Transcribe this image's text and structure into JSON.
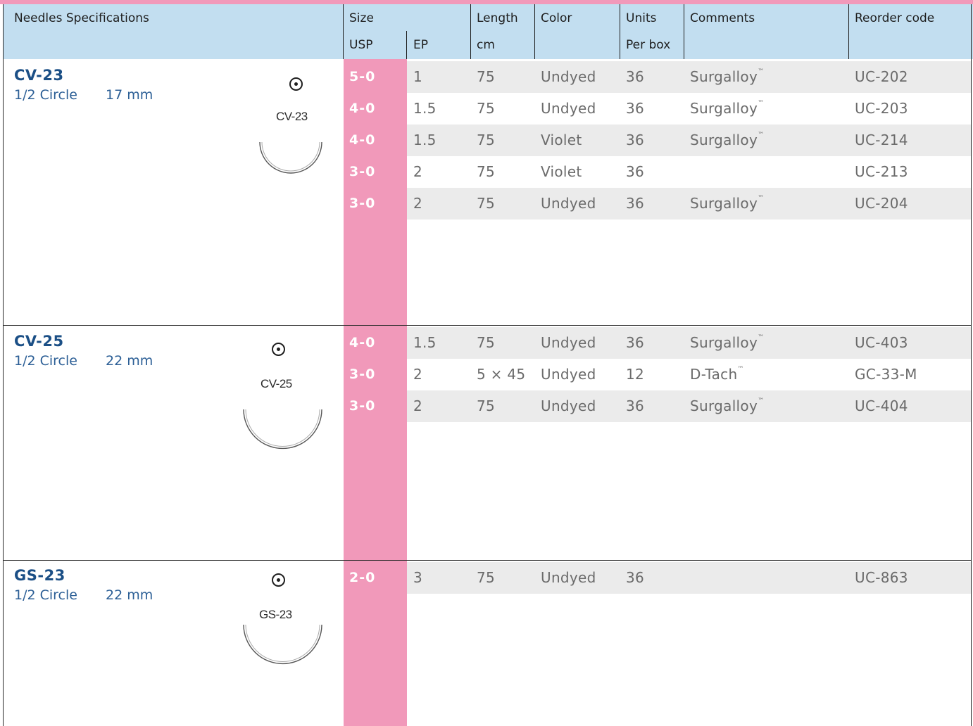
{
  "header": {
    "needles_spec": "Needles Specifications",
    "size": "Size",
    "usp": "USP",
    "ep": "EP",
    "length": "Length",
    "length_unit": "cm",
    "color": "Color",
    "units": "Units",
    "units_sub": "Per box",
    "comments": "Comments",
    "reorder_code": "Reorder code"
  },
  "colors": {
    "accent_pink": "#f199ba",
    "header_blue": "#c2def0",
    "needle_name_blue": "#1b4f86",
    "row_shade": "#ebebeb"
  },
  "groups": [
    {
      "name": "CV-23",
      "shape": "1/2 Circle",
      "size_mm": "17 mm",
      "icon_label": "CV-23",
      "icon": "taper-point-icon",
      "rows": [
        {
          "usp": "5-0",
          "ep": "1",
          "length": "75",
          "color": "Undyed",
          "units": "36",
          "comment": "Surgalloy",
          "tm": "™",
          "code": "UC-202"
        },
        {
          "usp": "4-0",
          "ep": "1.5",
          "length": "75",
          "color": "Undyed",
          "units": "36",
          "comment": "Surgalloy",
          "tm": "™",
          "code": "UC-203"
        },
        {
          "usp": "4-0",
          "ep": "1.5",
          "length": "75",
          "color": "Violet",
          "units": "36",
          "comment": "Surgalloy",
          "tm": "™",
          "code": "UC-214"
        },
        {
          "usp": "3-0",
          "ep": "2",
          "length": "75",
          "color": "Violet",
          "units": "36",
          "comment": "",
          "tm": "",
          "code": "UC-213"
        },
        {
          "usp": "3-0",
          "ep": "2",
          "length": "75",
          "color": "Undyed",
          "units": "36",
          "comment": "Surgalloy",
          "tm": "™",
          "code": "UC-204"
        }
      ]
    },
    {
      "name": "CV-25",
      "shape": "1/2 Circle",
      "size_mm": "22 mm",
      "icon_label": "CV-25",
      "icon": "taper-point-icon",
      "rows": [
        {
          "usp": "4-0",
          "ep": "1.5",
          "length": "75",
          "color": "Undyed",
          "units": "36",
          "comment": "Surgalloy",
          "tm": "™",
          "code": "UC-403"
        },
        {
          "usp": "3-0",
          "ep": "2",
          "length": "5 × 45",
          "color": "Undyed",
          "units": "12",
          "comment": "D-Tach",
          "tm": "™",
          "code": "GC-33-M"
        },
        {
          "usp": "3-0",
          "ep": "2",
          "length": "75",
          "color": "Undyed",
          "units": "36",
          "comment": "Surgalloy",
          "tm": "™",
          "code": "UC-404"
        }
      ]
    },
    {
      "name": "GS-23",
      "shape": "1/2 Circle",
      "size_mm": "22 mm",
      "icon_label": "GS-23",
      "icon": "taper-point-icon",
      "rows": [
        {
          "usp": "2-0",
          "ep": "3",
          "length": "75",
          "color": "Undyed",
          "units": "36",
          "comment": "",
          "tm": "",
          "code": "UC-863"
        }
      ]
    }
  ]
}
